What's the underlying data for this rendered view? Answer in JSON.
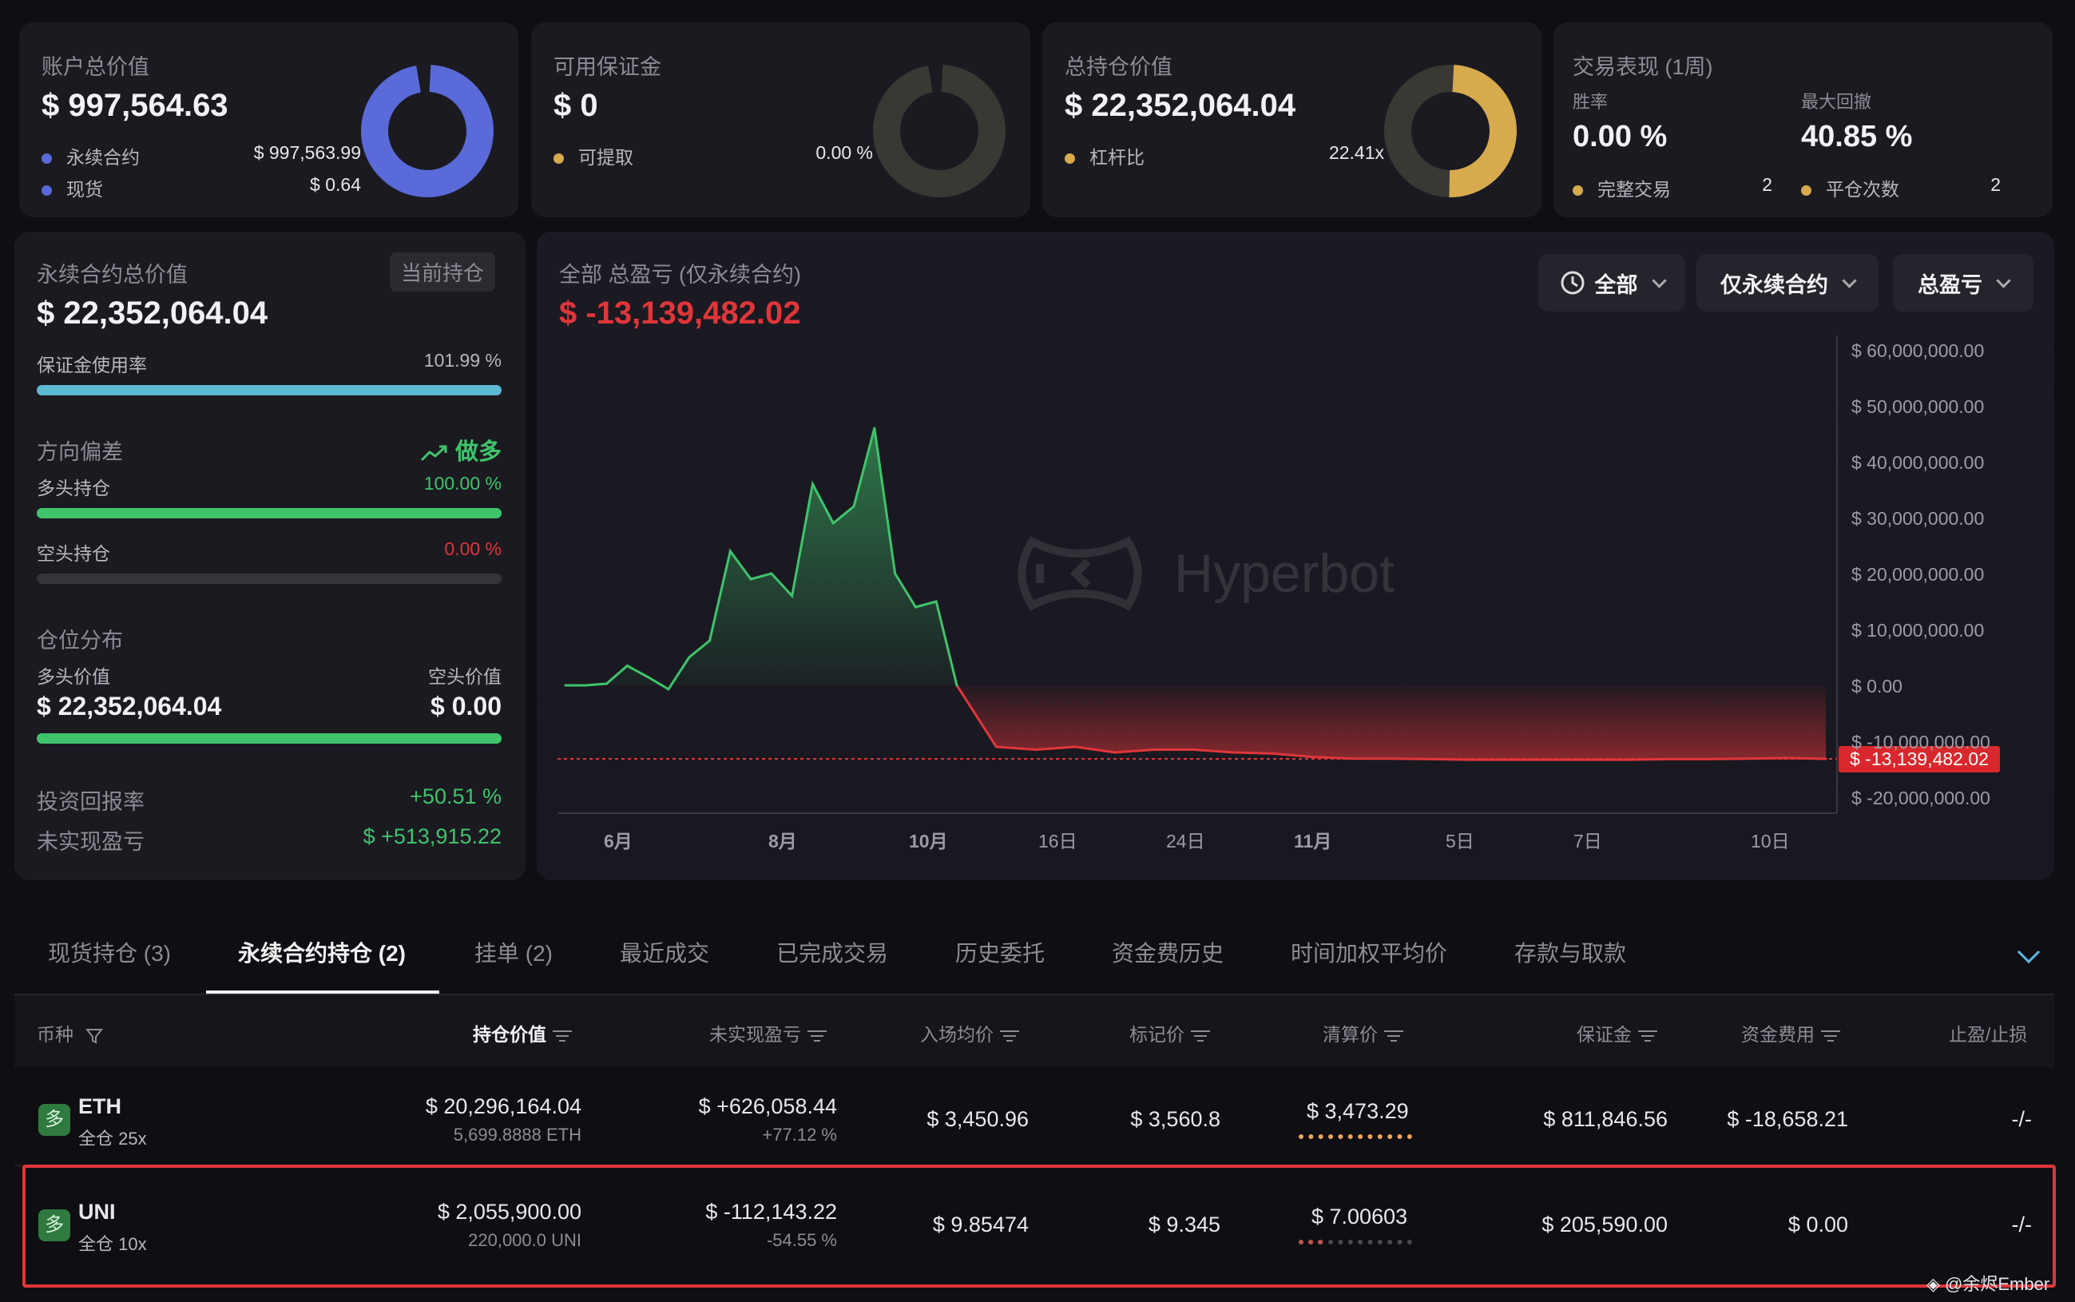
{
  "summary": {
    "account": {
      "title": "账户总价值",
      "value": "$ 997,564.63",
      "items": [
        {
          "label": "永续合约",
          "value": "$ 997,563.99"
        },
        {
          "label": "现货",
          "value": "$ 0.64"
        }
      ]
    },
    "margin": {
      "title": "可用保证金",
      "value": "$ 0",
      "items": [
        {
          "label": "可提取",
          "value": "0.00 %"
        }
      ]
    },
    "position": {
      "title": "总持仓价值",
      "value": "$ 22,352,064.04",
      "items": [
        {
          "label": "杠杆比",
          "value": "22.41x"
        }
      ]
    },
    "trading": {
      "title": "交易表现 (1周)",
      "win_label": "胜率",
      "win_value": "0.00 %",
      "dd_label": "最大回撤",
      "dd_value": "40.85 %",
      "complete_label": "完整交易",
      "complete_value": "2",
      "close_label": "平仓次数",
      "close_value": "2"
    },
    "colors": {
      "blue": "#5a6ad8",
      "gold": "#d6aa4d",
      "dark": "#3a3833",
      "green": "#3fc46b",
      "red": "#e0363a"
    }
  },
  "perp_panel": {
    "title": "永续合约总价值",
    "badge": "当前持仓",
    "value": "$ 22,352,064.04",
    "usage_label": "保证金使用率",
    "usage_value": "101.99 %",
    "usage_fraction": 1.0,
    "bias_label": "方向偏差",
    "bias_value": "做多",
    "long_label": "多头持仓",
    "long_value": "100.00 %",
    "long_fraction": 1.0,
    "short_label": "空头持仓",
    "short_value": "0.00 %",
    "short_fraction": 0.0,
    "dist_label": "仓位分布",
    "long_val_label": "多头价值",
    "short_val_label": "空头价值",
    "long_val": "$ 22,352,064.04",
    "short_val": "$ 0.00",
    "roi_label": "投资回报率",
    "roi_value": "+50.51 %",
    "upnl_label": "未实现盈亏",
    "upnl_value": "$ +513,915.22"
  },
  "pnl_chart": {
    "title": "全部 总盈亏 (仅永续合约)",
    "value": "$ -13,139,482.02",
    "filters": [
      "全部",
      "仅永续合约",
      "总盈亏"
    ],
    "watermark": "Hyperbot",
    "current_label": "$ -13,139,482.02"
  },
  "chart_data": {
    "type": "area",
    "x_ticks": [
      "6月",
      "8月",
      "10月",
      "16日",
      "24日",
      "11月",
      "5日",
      "7日",
      "10日"
    ],
    "y_ticks": [
      "$ 60,000,000.00",
      "$ 50,000,000.00",
      "$ 40,000,000.00",
      "$ 30,000,000.00",
      "$ 20,000,000.00",
      "$ 10,000,000.00",
      "$ 0.00",
      "$ -10,000,000.00",
      "$ -20,000,000.00"
    ],
    "ylim": [
      -20000000,
      60000000
    ],
    "series": [
      {
        "values": [
          0,
          0,
          300000,
          3500000,
          1500000,
          -700000,
          5000000,
          8000000,
          24000000,
          19000000,
          20000000,
          16000000,
          36000000,
          29000000,
          32000000,
          46000000,
          20000000,
          14000000,
          15000000,
          0,
          -11000000,
          -11500000,
          -11000000,
          -12000000,
          -11500000,
          -11500000,
          -12000000,
          -12200000,
          -12800000,
          -13100000,
          -13100000,
          -13200000,
          -13300000,
          -13300000,
          -13300000,
          -13300000,
          -13300000,
          -13200000,
          -13200000,
          -13100000,
          -13000000,
          -13139482
        ]
      }
    ],
    "reference": -13139482
  },
  "tabs": [
    "现货持仓 (3)",
    "永续合约持仓 (2)",
    "挂单 (2)",
    "最近成交",
    "已完成交易",
    "历史委托",
    "资金费历史",
    "时间加权平均价",
    "存款与取款"
  ],
  "table": {
    "headers": [
      "币种",
      "持仓价值",
      "未实现盈亏",
      "入场均价",
      "标记价",
      "清算价",
      "保证金",
      "资金费用",
      "止盈/止损"
    ],
    "rows": [
      {
        "side": "多",
        "coin": "ETH",
        "mode": "全仓 25x",
        "value": "$ 20,296,164.04",
        "size": "5,699.8888 ETH",
        "upnl": "$ +626,058.44",
        "upnl_pct": "+77.12 %",
        "entry": "$ 3,450.96",
        "mark": "$ 3,560.8",
        "liq": "$ 3,473.29",
        "margin": "$ 811,846.56",
        "funding": "$ -18,658.21",
        "tpsl": "-/-"
      },
      {
        "side": "多",
        "coin": "UNI",
        "mode": "全仓 10x",
        "value": "$ 2,055,900.00",
        "size": "220,000.0 UNI",
        "upnl": "$ -112,143.22",
        "upnl_pct": "-54.55 %",
        "entry": "$ 9.85474",
        "mark": "$ 9.345",
        "liq": "$ 7.00603",
        "margin": "$ 205,590.00",
        "funding": "$ 0.00",
        "tpsl": "-/-"
      }
    ]
  },
  "watermark_credit": "@余烬Ember"
}
